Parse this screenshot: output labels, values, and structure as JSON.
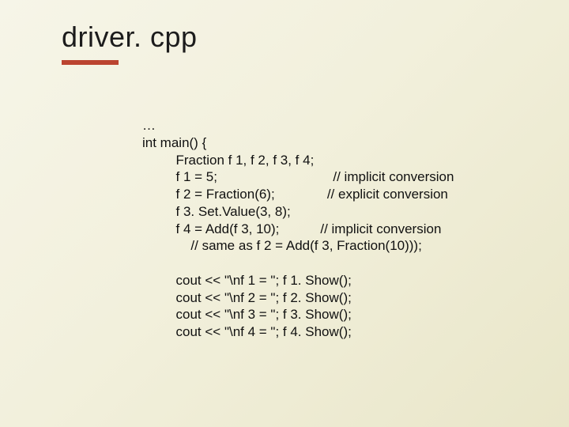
{
  "title": "driver. cpp",
  "code": "…\nint main() {\n         Fraction f 1, f 2, f 3, f 4;\n         f 1 = 5;                               // implicit conversion\n         f 2 = Fraction(6);              // explicit conversion\n         f 3. Set.Value(3, 8);\n         f 4 = Add(f 3, 10);           // implicit conversion\n             // same as f 2 = Add(f 3, Fraction(10)));\n\n         cout << \"\\nf 1 = \"; f 1. Show();\n         cout << \"\\nf 2 = \"; f 2. Show();\n         cout << \"\\nf 3 = \"; f 3. Show();\n         cout << \"\\nf 4 = \"; f 4. Show();"
}
